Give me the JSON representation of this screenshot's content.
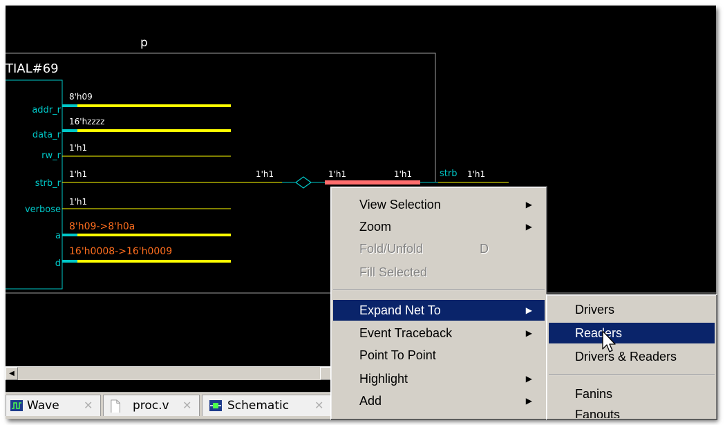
{
  "schematic": {
    "block_title": "p",
    "instance_label": "TIAL#69",
    "ports": [
      {
        "name": "addr_r",
        "value": "8'h09",
        "color": "#ffffff"
      },
      {
        "name": "data_r",
        "value": "16'hzzzz",
        "color": "#ffffff"
      },
      {
        "name": "rw_r",
        "value": "1'h1",
        "color": "#ffffff"
      },
      {
        "name": "strb_r",
        "value": "1'h1",
        "color": "#ffffff"
      },
      {
        "name": "verbose",
        "value": "1'h1",
        "color": "#ffffff"
      },
      {
        "name": "a",
        "value": "8'h09->8'h0a",
        "color": "#ff6e1e"
      },
      {
        "name": "d",
        "value": "16'h0008->16'h0009",
        "color": "#ff6e1e"
      }
    ],
    "strb_net_values": [
      "1'h1",
      "1'h1",
      "1'h1"
    ],
    "output_port": {
      "name": "strb",
      "value": "1'h1"
    },
    "colors": {
      "bus": "#ffff00",
      "port": "#00c8c8",
      "highlight_net": "#ff6e6e",
      "background": "#000000"
    }
  },
  "tabs": [
    {
      "label": "Wave",
      "icon": "wave-icon"
    },
    {
      "label": "proc.v",
      "icon": "document-icon"
    },
    {
      "label": "Schematic",
      "icon": "schematic-icon"
    }
  ],
  "context_menu": {
    "items": [
      {
        "label": "View Selection",
        "submenu": true,
        "disabled": false
      },
      {
        "label": "Zoom",
        "submenu": true,
        "disabled": false
      },
      {
        "label": "Fold/Unfold",
        "shortcut": "D",
        "disabled": true
      },
      {
        "label": "Fill Selected",
        "disabled": true
      },
      {
        "label": "Expand Net To",
        "submenu": true,
        "selected": true
      },
      {
        "label": "Event Traceback",
        "submenu": true
      },
      {
        "label": "Point To Point"
      },
      {
        "label": "Highlight",
        "submenu": true
      },
      {
        "label": "Add",
        "submenu": true
      }
    ]
  },
  "submenu": {
    "items": [
      {
        "label": "Drivers"
      },
      {
        "label": "Readers",
        "selected": true
      },
      {
        "label": "Drivers & Readers"
      },
      {
        "label": "Fanins"
      },
      {
        "label": "Fanouts"
      }
    ]
  }
}
